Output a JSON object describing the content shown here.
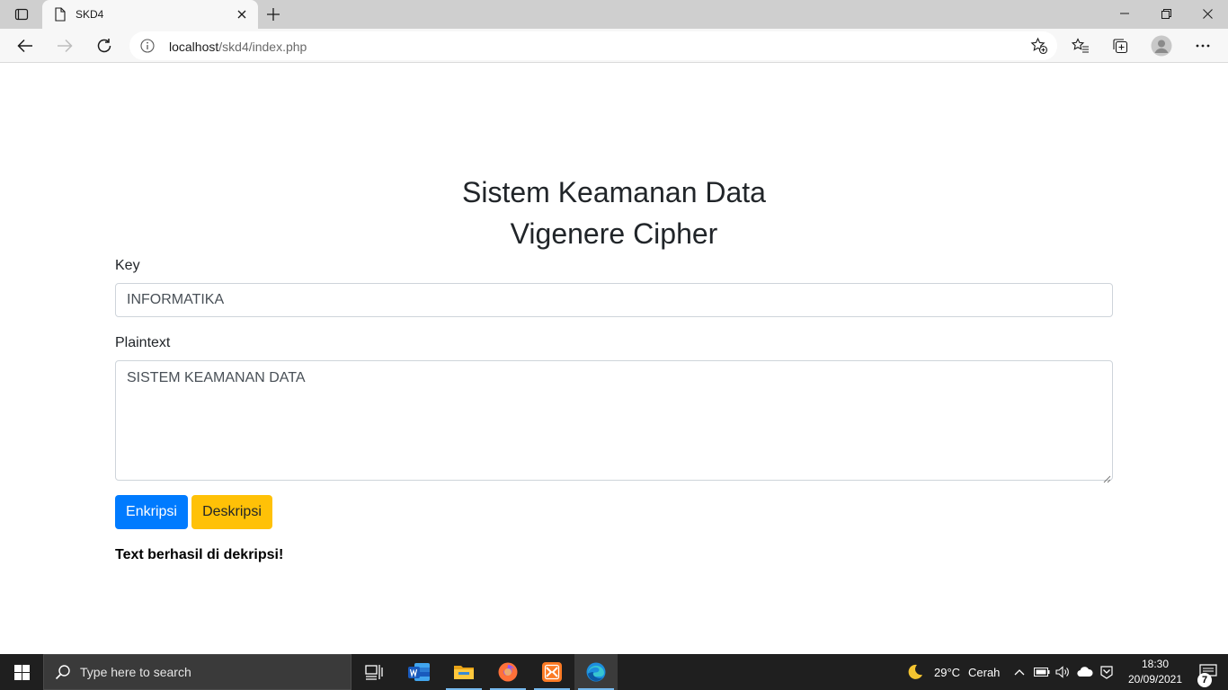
{
  "browser": {
    "tab": {
      "title": "SKD4"
    },
    "address": {
      "host": "localhost",
      "path": "/skd4/index.php"
    }
  },
  "page": {
    "title_line1": "Sistem Keamanan Data",
    "title_line2": "Vigenere Cipher",
    "key_label": "Key",
    "key_value": "INFORMATIKA",
    "plaintext_label": "Plaintext",
    "plaintext_value": "SISTEM KEAMANAN DATA",
    "encrypt_label": "Enkripsi",
    "decrypt_label": "Deskripsi",
    "status_message": "Text berhasil di dekripsi!"
  },
  "taskbar": {
    "search_placeholder": "Type here to search",
    "weather_temp": "29°C",
    "weather_text": "Cerah",
    "time": "18:30",
    "date": "20/09/2021",
    "notification_count": "7",
    "apps": [
      "task-view",
      "word",
      "file-explorer",
      "firefox",
      "xampp",
      "edge"
    ]
  },
  "colors": {
    "primary": "#007bff",
    "warning": "#ffc107",
    "taskbar": "#1f1f1f"
  }
}
